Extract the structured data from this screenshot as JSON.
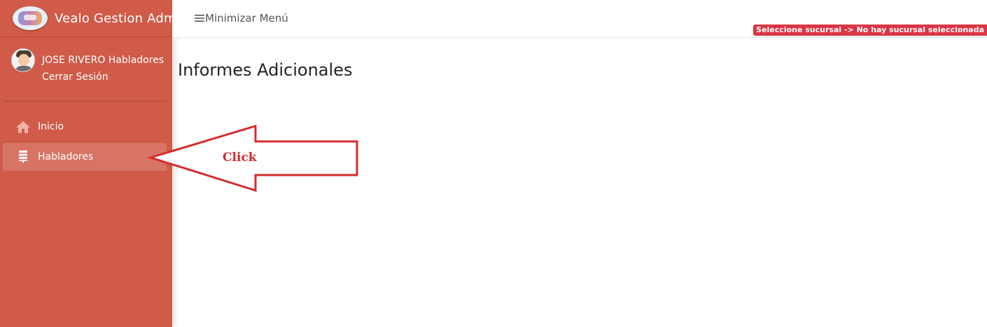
{
  "sidebar": {
    "brand_title": "Vealo Gestion Admin",
    "user_name": "JOSE RIVERO Habladores",
    "logout_label": "Cerrar Sesión",
    "items": [
      {
        "label": "Inicio",
        "icon": "home-icon",
        "active": false
      },
      {
        "label": "Habladores",
        "icon": "list-icon",
        "active": true
      }
    ]
  },
  "header": {
    "toggle_label": "Minimizar Menú",
    "branch_badge": "Seleccione sucursal -> No hay sucursal seleccionada"
  },
  "main": {
    "title": "Informes Adicionales"
  },
  "annotation": {
    "text": "Click"
  },
  "colors": {
    "sidebar_bg": "#cf5b48",
    "active_item_bg": "#d87465",
    "badge_bg": "#dc3545",
    "annotation_red": "#d52b2b"
  }
}
